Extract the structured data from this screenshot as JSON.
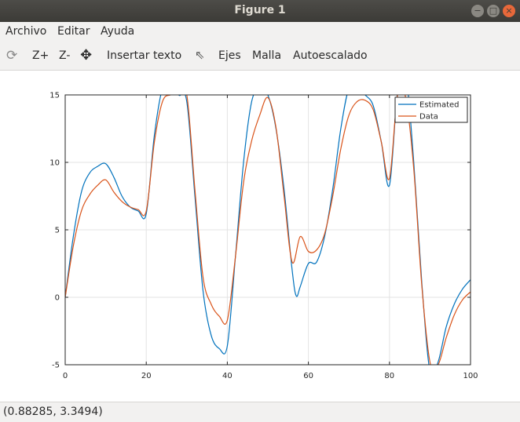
{
  "window": {
    "title": "Figure 1"
  },
  "menu": {
    "items": [
      "Archivo",
      "Editar",
      "Ayuda"
    ]
  },
  "toolbar": {
    "zoom_in": "Z+",
    "zoom_out": "Z-",
    "insert_text": "Insertar texto",
    "axes": "Ejes",
    "grid": "Malla",
    "autoscale": "Autoescalado"
  },
  "status": {
    "coords": "(0.88285, 3.3494)"
  },
  "colors": {
    "estimated": "#0072bd",
    "data": "#d95319"
  },
  "chart_data": {
    "type": "line",
    "xlim": [
      0,
      100
    ],
    "ylim": [
      -5,
      15
    ],
    "xticks": [
      0,
      20,
      40,
      60,
      80,
      100
    ],
    "yticks": [
      -5,
      0,
      5,
      10,
      15
    ],
    "grid": true,
    "legend_position": "top-right",
    "series": [
      {
        "name": "Estimated",
        "x": [
          0,
          2,
          4,
          6,
          8,
          10,
          12,
          14,
          16,
          18,
          20,
          22,
          24,
          26,
          28,
          30,
          32,
          34,
          36,
          38,
          40,
          42,
          44,
          46,
          48,
          50,
          52,
          54,
          56,
          57,
          58,
          60,
          62,
          64,
          66,
          68,
          70,
          72,
          74,
          76,
          78,
          80,
          82,
          84,
          86,
          88,
          90,
          92,
          94,
          96,
          98,
          100
        ],
        "y": [
          0,
          4.5,
          7.8,
          9.2,
          9.7,
          9.9,
          8.9,
          7.5,
          6.7,
          6.4,
          6.2,
          12.0,
          15.5,
          16.0,
          15.0,
          14.5,
          7.5,
          0.5,
          -2.8,
          -3.8,
          -3.6,
          3.0,
          10.0,
          14.5,
          15.5,
          15.0,
          12.5,
          8.0,
          2.0,
          0.1,
          0.8,
          2.5,
          2.6,
          4.5,
          8.0,
          12.5,
          15.5,
          15.6,
          15.0,
          14.2,
          11.5,
          8.3,
          15.2,
          16.5,
          10.0,
          1.0,
          -5.5,
          -4.8,
          -2.2,
          -0.5,
          0.6,
          1.3
        ]
      },
      {
        "name": "Data",
        "x": [
          0,
          2,
          4,
          6,
          8,
          10,
          12,
          14,
          16,
          18,
          20,
          22,
          24,
          26,
          28,
          30,
          32,
          34,
          36,
          38,
          40,
          42,
          44,
          46,
          48,
          50,
          52,
          54,
          56,
          58,
          60,
          62,
          64,
          66,
          68,
          70,
          72,
          74,
          76,
          78,
          80,
          82,
          84,
          86,
          88,
          90,
          92,
          94,
          96,
          98,
          100
        ],
        "y": [
          0,
          3.8,
          6.4,
          7.6,
          8.3,
          8.7,
          7.8,
          7.1,
          6.7,
          6.5,
          6.4,
          11.5,
          14.5,
          15.0,
          15.0,
          15.0,
          8.0,
          1.5,
          -0.5,
          -1.4,
          -1.7,
          3.0,
          8.5,
          11.6,
          13.5,
          14.8,
          12.6,
          7.5,
          2.6,
          4.5,
          3.4,
          3.5,
          4.7,
          7.5,
          11.0,
          13.5,
          14.5,
          14.6,
          13.9,
          11.5,
          8.8,
          15.0,
          14.8,
          9.5,
          0.8,
          -4.8,
          -5.0,
          -3.0,
          -1.3,
          -0.2,
          0.4
        ]
      }
    ]
  }
}
